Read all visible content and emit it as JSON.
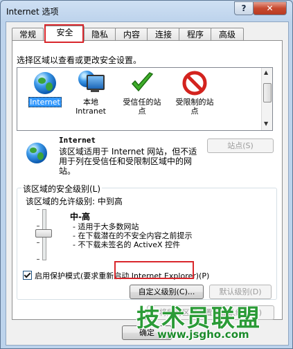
{
  "window": {
    "title": "Internet 选项",
    "help_label": "?",
    "close_label": "✕"
  },
  "tabs": [
    {
      "label": "常规"
    },
    {
      "label": "安全"
    },
    {
      "label": "隐私"
    },
    {
      "label": "内容"
    },
    {
      "label": "连接"
    },
    {
      "label": "程序"
    },
    {
      "label": "高级"
    }
  ],
  "active_tab": "安全",
  "security": {
    "prompt": "选择区域以查看或更改安全设置。",
    "zones": [
      {
        "label": "Internet",
        "icon": "globe-icon",
        "selected": true
      },
      {
        "label": "本地\nIntranet",
        "icon": "intranet-icon",
        "selected": false
      },
      {
        "label": "受信任的站\n点",
        "icon": "trusted-check-icon",
        "selected": false
      },
      {
        "label": "受限制的站\n点",
        "icon": "restricted-icon",
        "selected": false
      }
    ],
    "zone_info": {
      "title": "Internet",
      "description": "该区域适用于 Internet 网站，但不适用于列在受信任和受限制区域中的网站。",
      "sites_button": "站点(S)"
    },
    "level_group": {
      "title": "该区域的安全级别(L)",
      "allowed": "该区域的允许级别: 中到高",
      "level_name": "中-高",
      "bullets": [
        "- 适用于大多数网站",
        "- 在下载潜在的不安全内容之前提示",
        "- 不下载未签名的 ActiveX 控件"
      ],
      "slider_level_fraction": 0.6,
      "protected_mode_label": "启用保护模式(要求重新启动 Internet Explorer)(P)",
      "protected_mode_checked": true,
      "custom_button": "自定义级别(C)...",
      "default_button": "默认级别(D)"
    },
    "reset_all_button": "将所有区域重置为默认级别(R)"
  },
  "footer": {
    "ok_button": "确定"
  },
  "watermark": {
    "text": "技术员联盟",
    "url": "www.jsgho.com"
  },
  "colors": {
    "highlight_red": "#d9262b",
    "selection_blue": "#3399ff",
    "watermark_green": "#2b9b37"
  }
}
